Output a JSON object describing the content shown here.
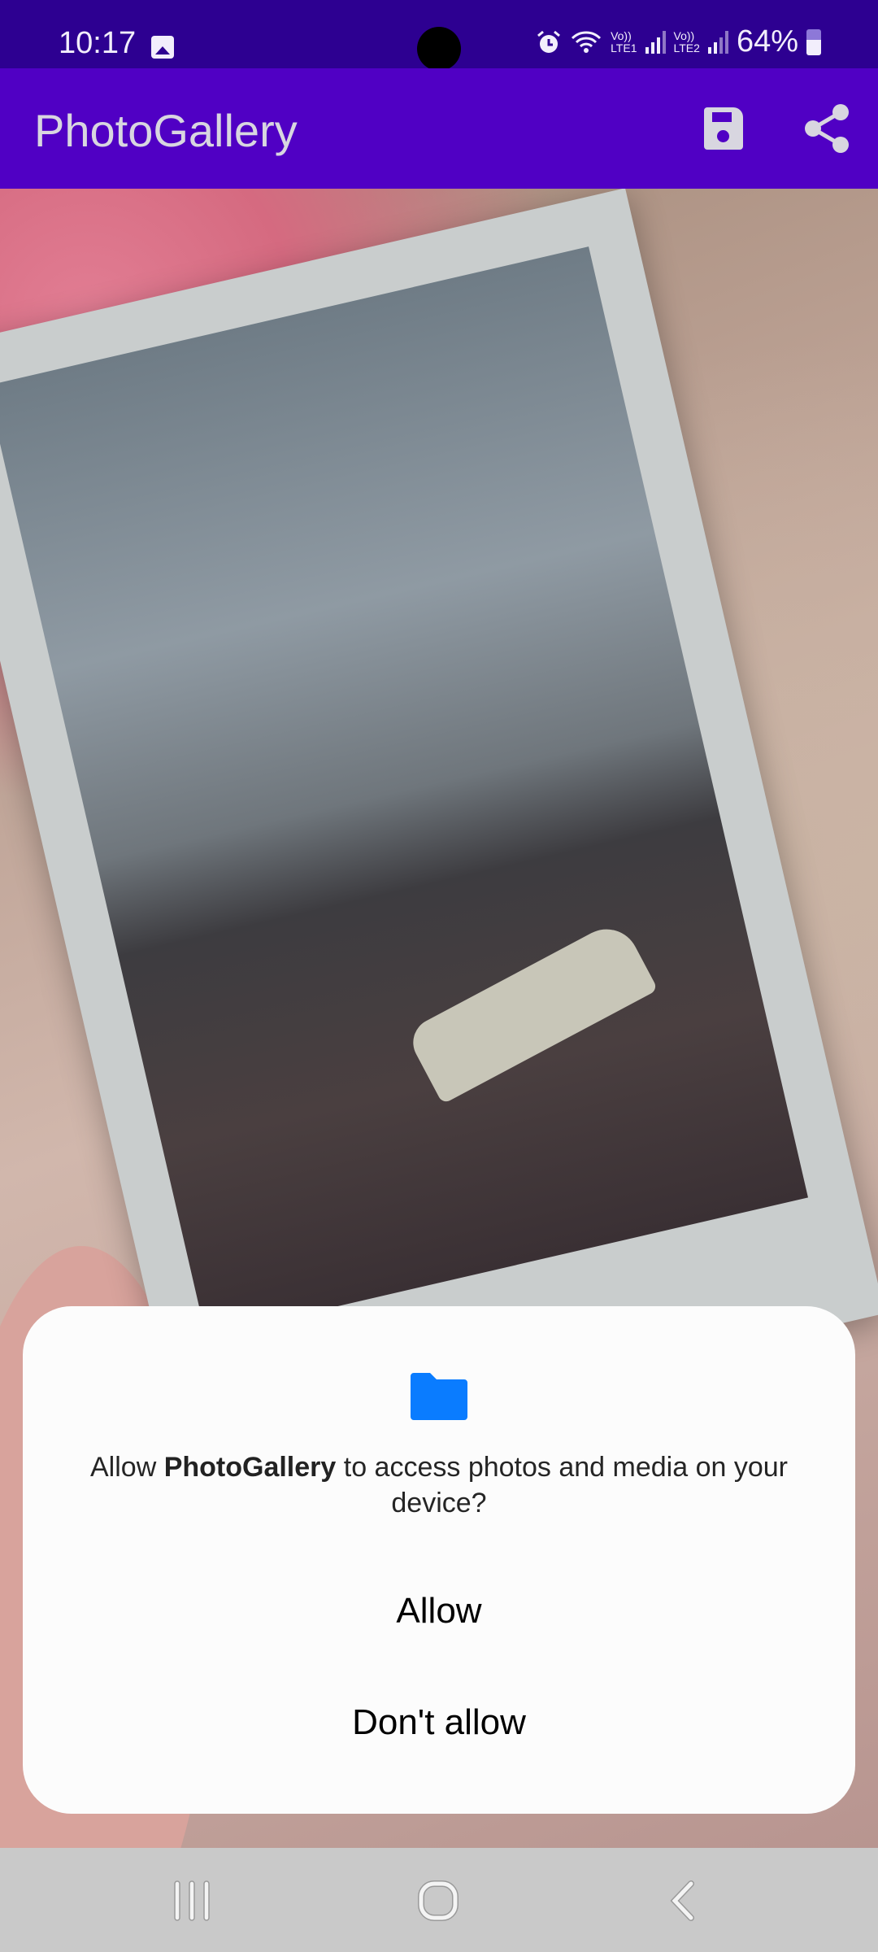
{
  "status_bar": {
    "time": "10:17",
    "battery": "64%",
    "sim1": {
      "volte": "Vo))",
      "network": "LTE1"
    },
    "sim2": {
      "volte": "Vo))",
      "network": "LTE2"
    },
    "icons": [
      "gallery-notification-icon",
      "alarm-icon",
      "wifi-icon",
      "signal-icon",
      "battery-icon"
    ]
  },
  "app_bar": {
    "title": "PhotoGallery",
    "actions": [
      "save-icon",
      "share-icon"
    ],
    "color": "#5000c4"
  },
  "dialog": {
    "icon": "folder-icon",
    "icon_color": "#0a7cff",
    "message_prefix": "Allow ",
    "app_name": "PhotoGallery",
    "message_suffix": " to access photos and media on your device?",
    "allow_label": "Allow",
    "deny_label": "Don't allow"
  },
  "nav_bar": {
    "buttons": [
      "recents-icon",
      "home-icon",
      "back-icon"
    ]
  }
}
